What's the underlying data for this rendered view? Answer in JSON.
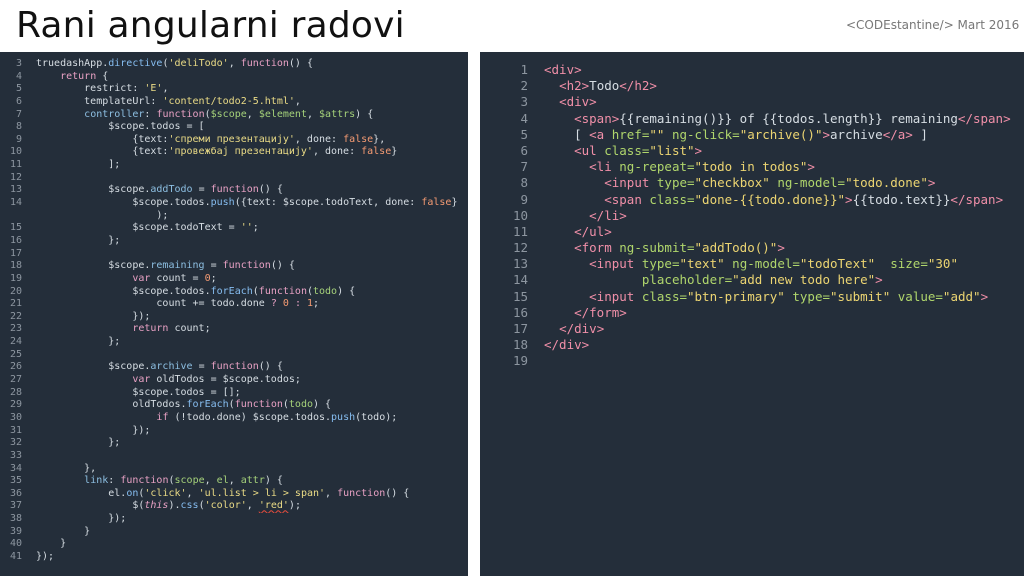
{
  "slide": {
    "title": "Rani angularni radovi",
    "meta": "<CODEstantine/>  Mart 2016"
  },
  "left_code": [
    {
      "n": "3",
      "segs": [
        [
          "p",
          "truedashApp."
        ],
        [
          "f",
          "directive"
        ],
        [
          "p",
          "("
        ],
        [
          "s",
          "'deliTodo'"
        ],
        [
          "p",
          ", "
        ],
        [
          "k",
          "function"
        ],
        [
          "p",
          "() {"
        ]
      ]
    },
    {
      "n": "4",
      "segs": [
        [
          "p",
          "    "
        ],
        [
          "k",
          "return"
        ],
        [
          "p",
          " {"
        ]
      ]
    },
    {
      "n": "5",
      "segs": [
        [
          "p",
          "        restrict: "
        ],
        [
          "s",
          "'E'"
        ],
        [
          "p",
          ","
        ]
      ]
    },
    {
      "n": "6",
      "segs": [
        [
          "p",
          "        templateUrl: "
        ],
        [
          "s",
          "'content/todo2-5.html'"
        ],
        [
          "p",
          ","
        ]
      ]
    },
    {
      "n": "7",
      "segs": [
        [
          "p",
          "        "
        ],
        [
          "b",
          "controller"
        ],
        [
          "p",
          ": "
        ],
        [
          "k",
          "function"
        ],
        [
          "p",
          "("
        ],
        [
          "v",
          "$scope"
        ],
        [
          "p",
          ", "
        ],
        [
          "v",
          "$element"
        ],
        [
          "p",
          ", "
        ],
        [
          "v",
          "$attrs"
        ],
        [
          "p",
          ") {"
        ]
      ]
    },
    {
      "n": "8",
      "segs": [
        [
          "p",
          "            $scope.todos = ["
        ]
      ]
    },
    {
      "n": "9",
      "segs": [
        [
          "p",
          "                {text:"
        ],
        [
          "s",
          "'спреми презентацију'"
        ],
        [
          "p",
          ", done: "
        ],
        [
          "n",
          "false"
        ],
        [
          "p",
          "},"
        ]
      ]
    },
    {
      "n": "10",
      "segs": [
        [
          "p",
          "                {text:"
        ],
        [
          "s",
          "'провежбај презентацију'"
        ],
        [
          "p",
          ", done: "
        ],
        [
          "n",
          "false"
        ],
        [
          "p",
          "}"
        ]
      ]
    },
    {
      "n": "11",
      "segs": [
        [
          "p",
          "            ];"
        ]
      ]
    },
    {
      "n": "12",
      "segs": [
        [
          "p",
          ""
        ]
      ]
    },
    {
      "n": "13",
      "segs": [
        [
          "p",
          "            $scope."
        ],
        [
          "b",
          "addTodo"
        ],
        [
          "p",
          " = "
        ],
        [
          "k",
          "function"
        ],
        [
          "p",
          "() {"
        ]
      ]
    },
    {
      "n": "14",
      "segs": [
        [
          "p",
          "                $scope.todos."
        ],
        [
          "f",
          "push"
        ],
        [
          "p",
          "({text: $scope.todoText, done: "
        ],
        [
          "n",
          "false"
        ],
        [
          "p",
          "}"
        ]
      ]
    },
    {
      "n": "",
      "segs": [
        [
          "p",
          "                    );"
        ]
      ]
    },
    {
      "n": "15",
      "segs": [
        [
          "p",
          "                $scope.todoText = "
        ],
        [
          "s",
          "''"
        ],
        [
          "p",
          ";"
        ]
      ]
    },
    {
      "n": "16",
      "segs": [
        [
          "p",
          "            };"
        ]
      ]
    },
    {
      "n": "17",
      "segs": [
        [
          "p",
          ""
        ]
      ]
    },
    {
      "n": "18",
      "segs": [
        [
          "p",
          "            $scope."
        ],
        [
          "b",
          "remaining"
        ],
        [
          "p",
          " = "
        ],
        [
          "k",
          "function"
        ],
        [
          "p",
          "() {"
        ]
      ]
    },
    {
      "n": "19",
      "segs": [
        [
          "p",
          "                "
        ],
        [
          "k",
          "var"
        ],
        [
          "p",
          " count = "
        ],
        [
          "n",
          "0"
        ],
        [
          "p",
          ";"
        ]
      ]
    },
    {
      "n": "20",
      "segs": [
        [
          "p",
          "                $scope.todos."
        ],
        [
          "f",
          "forEach"
        ],
        [
          "p",
          "("
        ],
        [
          "k",
          "function"
        ],
        [
          "p",
          "("
        ],
        [
          "v",
          "todo"
        ],
        [
          "p",
          ") {"
        ]
      ]
    },
    {
      "n": "21",
      "segs": [
        [
          "p",
          "                    count += todo.done "
        ],
        [
          "k",
          "?"
        ],
        [
          "p",
          " "
        ],
        [
          "n",
          "0"
        ],
        [
          "p",
          " "
        ],
        [
          "k",
          ":"
        ],
        [
          "p",
          " "
        ],
        [
          "n",
          "1"
        ],
        [
          "p",
          ";"
        ]
      ]
    },
    {
      "n": "22",
      "segs": [
        [
          "p",
          "                });"
        ]
      ]
    },
    {
      "n": "23",
      "segs": [
        [
          "p",
          "                "
        ],
        [
          "k",
          "return"
        ],
        [
          "p",
          " count;"
        ]
      ]
    },
    {
      "n": "24",
      "segs": [
        [
          "p",
          "            };"
        ]
      ]
    },
    {
      "n": "25",
      "segs": [
        [
          "p",
          ""
        ]
      ]
    },
    {
      "n": "26",
      "segs": [
        [
          "p",
          "            $scope."
        ],
        [
          "b",
          "archive"
        ],
        [
          "p",
          " = "
        ],
        [
          "k",
          "function"
        ],
        [
          "p",
          "() {"
        ]
      ]
    },
    {
      "n": "27",
      "segs": [
        [
          "p",
          "                "
        ],
        [
          "k",
          "var"
        ],
        [
          "p",
          " oldTodos = $scope.todos;"
        ]
      ]
    },
    {
      "n": "28",
      "segs": [
        [
          "p",
          "                $scope.todos = [];"
        ]
      ]
    },
    {
      "n": "29",
      "segs": [
        [
          "p",
          "                oldTodos."
        ],
        [
          "f",
          "forEach"
        ],
        [
          "p",
          "("
        ],
        [
          "k",
          "function"
        ],
        [
          "p",
          "("
        ],
        [
          "v",
          "todo"
        ],
        [
          "p",
          ") {"
        ]
      ]
    },
    {
      "n": "30",
      "segs": [
        [
          "p",
          "                    "
        ],
        [
          "k",
          "if"
        ],
        [
          "p",
          " (!todo.done) $scope.todos."
        ],
        [
          "f",
          "push"
        ],
        [
          "p",
          "(todo);"
        ]
      ]
    },
    {
      "n": "31",
      "segs": [
        [
          "p",
          "                });"
        ]
      ]
    },
    {
      "n": "32",
      "segs": [
        [
          "p",
          "            };"
        ]
      ]
    },
    {
      "n": "33",
      "segs": [
        [
          "p",
          ""
        ]
      ]
    },
    {
      "n": "34",
      "segs": [
        [
          "p",
          "        },"
        ]
      ]
    },
    {
      "n": "35",
      "segs": [
        [
          "p",
          "        "
        ],
        [
          "b",
          "link"
        ],
        [
          "p",
          ": "
        ],
        [
          "k",
          "function"
        ],
        [
          "p",
          "("
        ],
        [
          "v",
          "scope"
        ],
        [
          "p",
          ", "
        ],
        [
          "v",
          "el"
        ],
        [
          "p",
          ", "
        ],
        [
          "v",
          "attr"
        ],
        [
          "p",
          ") {"
        ]
      ]
    },
    {
      "n": "36",
      "segs": [
        [
          "p",
          "            el."
        ],
        [
          "f",
          "on"
        ],
        [
          "p",
          "("
        ],
        [
          "s",
          "'click'"
        ],
        [
          "p",
          ", "
        ],
        [
          "s",
          "'ul.list > li > span'"
        ],
        [
          "p",
          ", "
        ],
        [
          "k",
          "function"
        ],
        [
          "p",
          "() {"
        ]
      ]
    },
    {
      "n": "37",
      "segs": [
        [
          "p",
          "                $("
        ],
        [
          "i",
          "this"
        ],
        [
          "p",
          ")."
        ],
        [
          "f",
          "css"
        ],
        [
          "p",
          "("
        ],
        [
          "s",
          "'color'"
        ],
        [
          "p",
          ", "
        ],
        [
          "u",
          "'red'"
        ],
        [
          "p",
          ");"
        ]
      ]
    },
    {
      "n": "38",
      "segs": [
        [
          "p",
          "            });"
        ]
      ]
    },
    {
      "n": "39",
      "segs": [
        [
          "p",
          "        }"
        ]
      ]
    },
    {
      "n": "40",
      "segs": [
        [
          "p",
          "    }"
        ]
      ]
    },
    {
      "n": "41",
      "segs": [
        [
          "p",
          "});"
        ]
      ]
    }
  ],
  "right_code": [
    {
      "n": "1",
      "segs": [
        [
          "tag",
          "<div>"
        ]
      ]
    },
    {
      "n": "2",
      "segs": [
        [
          "p",
          "  "
        ],
        [
          "tag",
          "<h2>"
        ],
        [
          "p",
          "Todo"
        ],
        [
          "tag",
          "</h2>"
        ]
      ]
    },
    {
      "n": "3",
      "segs": [
        [
          "p",
          "  "
        ],
        [
          "tag",
          "<div>"
        ]
      ]
    },
    {
      "n": "4",
      "segs": [
        [
          "p",
          "    "
        ],
        [
          "tag",
          "<span>"
        ],
        [
          "p",
          "{{remaining()}} of {{todos.length}} remaining"
        ],
        [
          "tag",
          "</span>"
        ]
      ]
    },
    {
      "n": "5",
      "segs": [
        [
          "p",
          "    [ "
        ],
        [
          "tag",
          "<a "
        ],
        [
          "attr",
          "href="
        ],
        [
          "val",
          "\"\""
        ],
        [
          "p",
          " "
        ],
        [
          "attr",
          "ng-click="
        ],
        [
          "val",
          "\"archive()\""
        ],
        [
          "tag",
          ">"
        ],
        [
          "p",
          "archive"
        ],
        [
          "tag",
          "</a>"
        ],
        [
          "p",
          " ]"
        ]
      ]
    },
    {
      "n": "6",
      "segs": [
        [
          "p",
          "    "
        ],
        [
          "tag",
          "<ul "
        ],
        [
          "attr",
          "class="
        ],
        [
          "val",
          "\"list\""
        ],
        [
          "tag",
          ">"
        ]
      ]
    },
    {
      "n": "7",
      "segs": [
        [
          "p",
          "      "
        ],
        [
          "tag",
          "<li "
        ],
        [
          "attr",
          "ng-repeat="
        ],
        [
          "val",
          "\"todo in todos\""
        ],
        [
          "tag",
          ">"
        ]
      ]
    },
    {
      "n": "8",
      "segs": [
        [
          "p",
          "        "
        ],
        [
          "tag",
          "<input "
        ],
        [
          "attr",
          "type="
        ],
        [
          "val",
          "\"checkbox\""
        ],
        [
          "p",
          " "
        ],
        [
          "attr",
          "ng-model="
        ],
        [
          "val",
          "\"todo.done\""
        ],
        [
          "tag",
          ">"
        ]
      ]
    },
    {
      "n": "9",
      "segs": [
        [
          "p",
          "        "
        ],
        [
          "tag",
          "<span "
        ],
        [
          "attr",
          "class="
        ],
        [
          "val",
          "\"done-{{todo.done}}\""
        ],
        [
          "tag",
          ">"
        ],
        [
          "p",
          "{{todo.text}}"
        ],
        [
          "tag",
          "</span>"
        ]
      ]
    },
    {
      "n": "10",
      "segs": [
        [
          "p",
          "      "
        ],
        [
          "tag",
          "</li>"
        ]
      ]
    },
    {
      "n": "11",
      "segs": [
        [
          "p",
          "    "
        ],
        [
          "tag",
          "</ul>"
        ]
      ]
    },
    {
      "n": "12",
      "segs": [
        [
          "p",
          "    "
        ],
        [
          "tag",
          "<form "
        ],
        [
          "attr",
          "ng-submit="
        ],
        [
          "val",
          "\"addTodo()\""
        ],
        [
          "tag",
          ">"
        ]
      ]
    },
    {
      "n": "13",
      "segs": [
        [
          "p",
          "      "
        ],
        [
          "tag",
          "<input "
        ],
        [
          "attr",
          "type="
        ],
        [
          "val",
          "\"text\""
        ],
        [
          "p",
          " "
        ],
        [
          "attr",
          "ng-model="
        ],
        [
          "val",
          "\"todoText\""
        ],
        [
          "p",
          "  "
        ],
        [
          "attr",
          "size="
        ],
        [
          "val",
          "\"30\""
        ]
      ]
    },
    {
      "n": "14",
      "segs": [
        [
          "p",
          "             "
        ],
        [
          "attr",
          "placeholder="
        ],
        [
          "val",
          "\"add new todo here\""
        ],
        [
          "tag",
          ">"
        ]
      ]
    },
    {
      "n": "15",
      "segs": [
        [
          "p",
          "      "
        ],
        [
          "tag",
          "<input "
        ],
        [
          "attr",
          "class="
        ],
        [
          "val",
          "\"btn-primary\""
        ],
        [
          "p",
          " "
        ],
        [
          "attr",
          "type="
        ],
        [
          "val",
          "\"submit\""
        ],
        [
          "p",
          " "
        ],
        [
          "attr",
          "value="
        ],
        [
          "val",
          "\"add\""
        ],
        [
          "tag",
          ">"
        ]
      ]
    },
    {
      "n": "16",
      "segs": [
        [
          "p",
          "    "
        ],
        [
          "tag",
          "</form>"
        ]
      ]
    },
    {
      "n": "17",
      "segs": [
        [
          "p",
          "  "
        ],
        [
          "tag",
          "</div>"
        ]
      ]
    },
    {
      "n": "18",
      "segs": [
        [
          "tag",
          "</div>"
        ]
      ]
    },
    {
      "n": "19",
      "segs": [
        [
          "p",
          ""
        ]
      ]
    }
  ]
}
